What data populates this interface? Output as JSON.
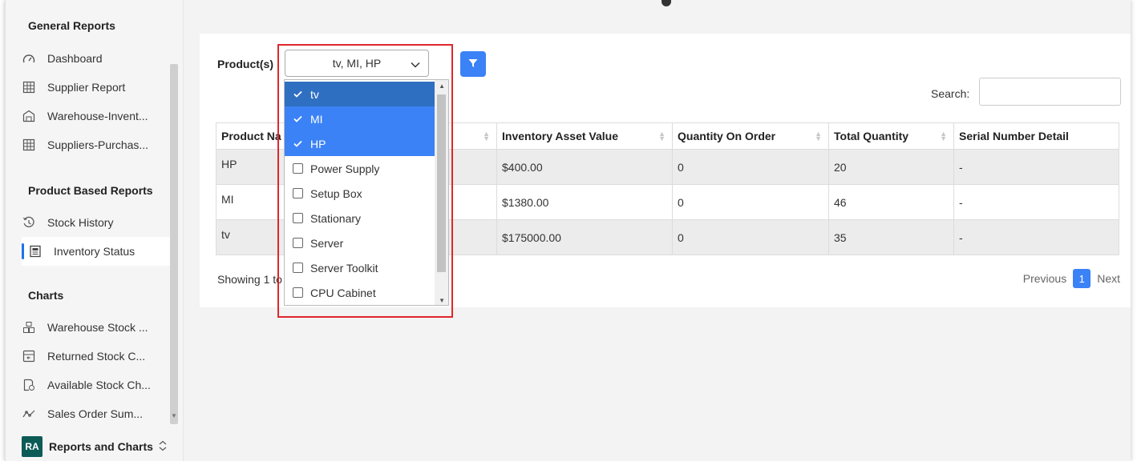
{
  "sidebar": {
    "sections": {
      "general": "General Reports",
      "product": "Product Based Reports",
      "charts": "Charts"
    },
    "general_items": [
      {
        "label": "Dashboard",
        "icon": "gauge-icon"
      },
      {
        "label": "Supplier Report",
        "icon": "grid-report-icon"
      },
      {
        "label": "Warehouse-Invent...",
        "icon": "warehouse-icon"
      },
      {
        "label": "Suppliers-Purchas...",
        "icon": "grid-report-icon"
      }
    ],
    "product_items": [
      {
        "label": "Stock History",
        "icon": "history-icon"
      },
      {
        "label": "Inventory Status",
        "icon": "newspaper-icon"
      }
    ],
    "chart_items": [
      {
        "label": "Warehouse Stock ...",
        "icon": "boxes-icon"
      },
      {
        "label": "Returned Stock C...",
        "icon": "return-box-icon"
      },
      {
        "label": "Available Stock Ch...",
        "icon": "document-clock-icon"
      },
      {
        "label": "Sales Order Sum...",
        "icon": "trend-line-icon"
      }
    ],
    "footer": {
      "avatar": "RA",
      "label": "Reports and Charts",
      "chevron": "⌃⌄"
    }
  },
  "filter": {
    "label": "Product(s)",
    "selected": "tv, MI, HP"
  },
  "search": {
    "label": "Search:",
    "value": ""
  },
  "table": {
    "columns": [
      "Product Na",
      "Inventory Asset Value",
      "Quantity On Order",
      "Total Quantity",
      "Serial Number Detail"
    ],
    "rows": [
      {
        "product": "HP",
        "asset": "$400.00",
        "on_order": "0",
        "total": "20",
        "serial": "-"
      },
      {
        "product": "MI",
        "asset": "$1380.00",
        "on_order": "0",
        "total": "46",
        "serial": "-"
      },
      {
        "product": "tv",
        "asset": "$175000.00",
        "on_order": "0",
        "total": "35",
        "serial": "-"
      }
    ]
  },
  "footer": {
    "showing": "Showing 1 to",
    "previous": "Previous",
    "page": "1",
    "next": "Next"
  },
  "dropdown": {
    "options": [
      {
        "label": "tv",
        "checked": true
      },
      {
        "label": "MI",
        "checked": true
      },
      {
        "label": "HP",
        "checked": true
      },
      {
        "label": "Power Supply",
        "checked": false
      },
      {
        "label": "Setup Box",
        "checked": false
      },
      {
        "label": "Stationary",
        "checked": false
      },
      {
        "label": "Server",
        "checked": false
      },
      {
        "label": "Server Toolkit",
        "checked": false
      },
      {
        "label": "CPU Cabinet",
        "checked": false
      }
    ]
  },
  "colors": {
    "accent": "#3b82f6",
    "highlight_border": "#e0262d",
    "avatar_bg": "#0c5b57"
  }
}
